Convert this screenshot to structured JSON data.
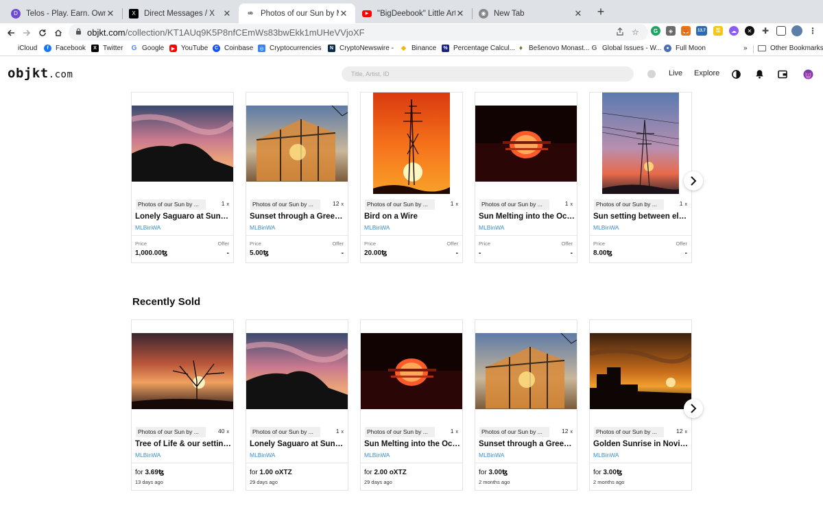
{
  "browser": {
    "tabs": [
      {
        "title": "Telos - Play. Earn. Own.",
        "icon": "telos-icon",
        "color": "#6c4bd1"
      },
      {
        "title": "Direct Messages / X",
        "icon": "x-icon",
        "color": "#000000"
      },
      {
        "title": "Photos of our Sun by MLBinWA",
        "icon": "objkt-icon",
        "color": "#222222"
      },
      {
        "title": "\"BigDeebook\" Little Artist | Vo",
        "icon": "youtube-icon",
        "color": "#ff0000"
      },
      {
        "title": "New Tab",
        "icon": "chrome-icon",
        "color": "#666666"
      }
    ],
    "new_tab_glyph": "+",
    "url_host": "objkt.com",
    "url_path": "/collection/KT1AUq9K5P8nfCEmWs83bwEkk1mUHeVVjoXF",
    "extension_badge": "13.7",
    "bookmarks": [
      {
        "label": "iCloud",
        "color": "#555555",
        "glyph": ""
      },
      {
        "label": "Facebook",
        "color": "#1877f2",
        "glyph": "f"
      },
      {
        "label": "Twitter",
        "color": "#000000",
        "glyph": "X"
      },
      {
        "label": "Google",
        "color": "#ffffff",
        "glyph": "G"
      },
      {
        "label": "YouTube",
        "color": "#ff0000",
        "glyph": "▶"
      },
      {
        "label": "Coinbase",
        "color": "#1652f0",
        "glyph": "C"
      },
      {
        "label": "Cryptocurrencies",
        "color": "#3b82f6",
        "glyph": "◎"
      },
      {
        "label": "CryptoNewswire -",
        "color": "#0b2c4a",
        "glyph": "N"
      },
      {
        "label": "Binance",
        "color": "#f0b90b",
        "glyph": "◆"
      },
      {
        "label": "Percentage Calcul...",
        "color": "#1a237e",
        "glyph": "%"
      },
      {
        "label": "Bešenovo Monast...",
        "color": "#6b7a2a",
        "glyph": "♦"
      },
      {
        "label": "Global Issues - W...",
        "color": "#ffffff",
        "glyph": "G"
      },
      {
        "label": "Full Moon",
        "color": "#4a6fb5",
        "glyph": "●"
      }
    ],
    "bookmarks_overflow": "»",
    "other_bookmarks": "Other Bookmarks"
  },
  "site": {
    "logo": "objkt",
    "logo_suffix": ".com",
    "search_placeholder": "Title, Artist, ID",
    "nav": {
      "live": "Live",
      "explore": "Explore"
    }
  },
  "collection_cards": [
    {
      "chip": "Photos of our Sun by ...",
      "editions": "1",
      "title": "Lonely Saguaro at Sunset",
      "artist": "MLBinWA",
      "price_label": "Price",
      "price": "1,000.00ꜩ",
      "offer_label": "Offer",
      "offer": "-",
      "image": "saguaro"
    },
    {
      "chip": "Photos of our Sun by ...",
      "editions": "12",
      "title": "Sunset through a Greenhouse",
      "artist": "MLBinWA",
      "price_label": "Price",
      "price": "5.00ꜩ",
      "offer_label": "Offer",
      "offer": "-",
      "image": "greenhouse"
    },
    {
      "chip": "Photos of our Sun by ...",
      "editions": "1",
      "title": "Bird on a Wire",
      "artist": "MLBinWA",
      "price_label": "Price",
      "price": "20.00ꜩ",
      "offer_label": "Offer",
      "offer": "-",
      "image": "wire"
    },
    {
      "chip": "Photos of our Sun by ...",
      "editions": "1",
      "title": "Sun Melting into the Ocean",
      "artist": "MLBinWA",
      "price_label": "Price",
      "price": "-",
      "offer_label": "Offer",
      "offer": "-",
      "image": "ocean"
    },
    {
      "chip": "Photos of our Sun by ...",
      "editions": "1",
      "title": "Sun setting between electric lines",
      "artist": "MLBinWA",
      "price_label": "Price",
      "price": "8.00ꜩ",
      "offer_label": "Offer",
      "offer": "-",
      "image": "pylon"
    }
  ],
  "recently_sold": {
    "title": "Recently Sold",
    "cards": [
      {
        "chip": "Photos of our Sun by ...",
        "editions": "40",
        "title": "Tree of Life & our setting Sun",
        "artist": "MLBinWA",
        "for": "for",
        "amount": "3.69ꜩ",
        "ago": "13 days ago",
        "image": "tree"
      },
      {
        "chip": "Photos of our Sun by ...",
        "editions": "1",
        "title": "Lonely Saguaro at Sunset",
        "artist": "MLBinWA",
        "for": "for",
        "amount": "1.00 oXTZ",
        "ago": "29 days ago",
        "image": "saguaro"
      },
      {
        "chip": "Photos of our Sun by ...",
        "editions": "1",
        "title": "Sun Melting into the Ocean",
        "artist": "MLBinWA",
        "for": "for",
        "amount": "2.00 oXTZ",
        "ago": "29 days ago",
        "image": "ocean"
      },
      {
        "chip": "Photos of our Sun by ...",
        "editions": "12",
        "title": "Sunset through a Greenhouse",
        "artist": "MLBinWA",
        "for": "for",
        "amount": "3.00ꜩ",
        "ago": "2 months ago",
        "image": "greenhouse"
      },
      {
        "chip": "Photos of our Sun by ...",
        "editions": "12",
        "title": "Golden Sunrise in Novi Sad",
        "artist": "MLBinWA",
        "for": "for",
        "amount": "3.00ꜩ",
        "ago": "2 months ago",
        "image": "novisad"
      }
    ]
  },
  "edition_mult": "x"
}
